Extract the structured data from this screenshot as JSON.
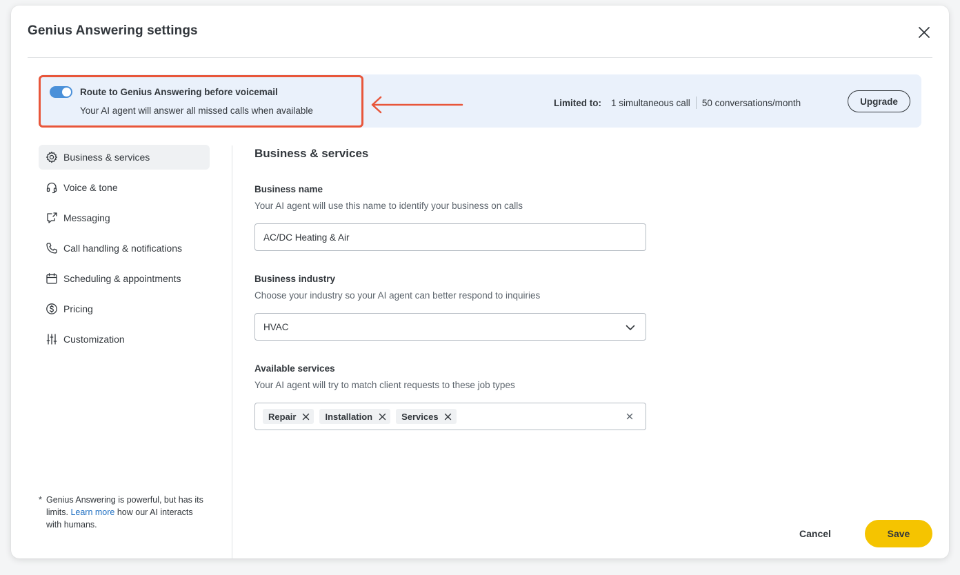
{
  "modal": {
    "title": "Genius Answering settings",
    "close_icon": "close-icon"
  },
  "banner": {
    "toggle_on": true,
    "route_title": "Route to Genius Answering before voicemail",
    "route_description": "Your AI agent will answer all missed calls when available",
    "limited_label": "Limited to:",
    "limit_calls": "1 simultaneous call",
    "limit_conversations": "50 conversations/month",
    "upgrade_label": "Upgrade",
    "highlight_color": "#e8563a",
    "background_color": "#eaf1fb"
  },
  "sidebar": {
    "items": [
      {
        "label": "Business & services",
        "icon": "gear-icon",
        "active": true
      },
      {
        "label": "Voice & tone",
        "icon": "headset-icon",
        "active": false
      },
      {
        "label": "Messaging",
        "icon": "message-icon",
        "active": false
      },
      {
        "label": "Call handling & notifications",
        "icon": "phone-icon",
        "active": false
      },
      {
        "label": "Scheduling & appointments",
        "icon": "calendar-icon",
        "active": false
      },
      {
        "label": "Pricing",
        "icon": "dollar-icon",
        "active": false
      },
      {
        "label": "Customization",
        "icon": "sliders-icon",
        "active": false
      }
    ],
    "footnote": {
      "star": "*",
      "text_before": "Genius Answering is powerful, but has its limits.",
      "link": "Learn more",
      "text_after": "how our AI interacts with humans."
    }
  },
  "main": {
    "section_title": "Business & services",
    "business_name": {
      "label": "Business name",
      "help": "Your AI agent will use this name to identify your business on calls",
      "value": "AC/DC Heating & Air"
    },
    "business_industry": {
      "label": "Business industry",
      "help": "Choose your industry so your AI agent can better respond to inquiries",
      "value": "HVAC"
    },
    "available_services": {
      "label": "Available services",
      "help": "Your AI agent will try to match client requests to these job types",
      "chips": [
        "Repair",
        "Installation",
        "Services"
      ]
    }
  },
  "footer": {
    "cancel_label": "Cancel",
    "save_label": "Save",
    "save_color": "#f5c400"
  }
}
